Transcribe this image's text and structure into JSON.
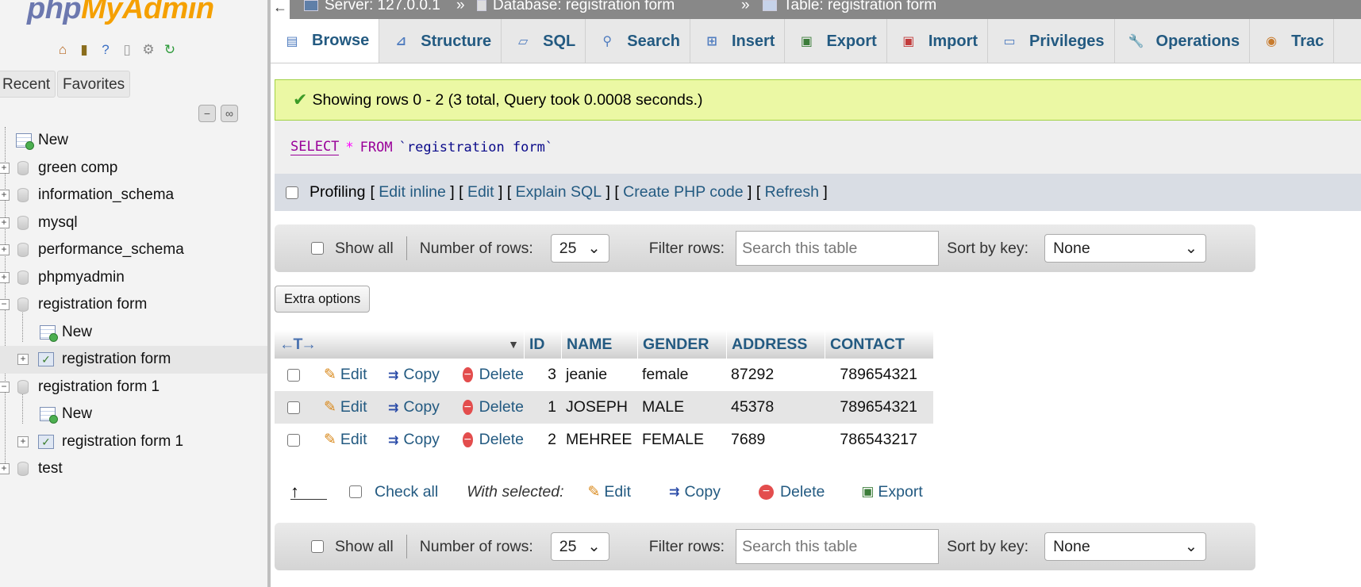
{
  "sidebar": {
    "logo_php": "php",
    "logo_myadmin": "MyAdmin",
    "tabs": {
      "recent": "Recent",
      "favorites": "Favorites"
    },
    "tree": [
      {
        "label": "New",
        "type": "new"
      },
      {
        "label": "green comp",
        "type": "db"
      },
      {
        "label": "information_schema",
        "type": "db"
      },
      {
        "label": "mysql",
        "type": "db"
      },
      {
        "label": "performance_schema",
        "type": "db"
      },
      {
        "label": "phpmyadmin",
        "type": "db"
      },
      {
        "label": "registration form",
        "type": "db-open"
      },
      {
        "label": "New",
        "type": "child-new"
      },
      {
        "label": "registration form",
        "type": "child-table"
      },
      {
        "label": "registration form 1",
        "type": "db-open"
      },
      {
        "label": "New",
        "type": "child-new"
      },
      {
        "label": "registration form 1",
        "type": "child-table"
      },
      {
        "label": "test",
        "type": "db"
      }
    ]
  },
  "breadcrumb": {
    "server": "Server: 127.0.0.1",
    "sep": "»",
    "database": "Database: registration form",
    "table": "Table: registration form"
  },
  "tabs": [
    {
      "label": "Browse",
      "icon": "browse-icon",
      "active": true
    },
    {
      "label": "Structure",
      "icon": "structure-icon"
    },
    {
      "label": "SQL",
      "icon": "sql-icon"
    },
    {
      "label": "Search",
      "icon": "search-icon"
    },
    {
      "label": "Insert",
      "icon": "insert-icon"
    },
    {
      "label": "Export",
      "icon": "export-icon"
    },
    {
      "label": "Import",
      "icon": "import-icon"
    },
    {
      "label": "Privileges",
      "icon": "privileges-icon"
    },
    {
      "label": "Operations",
      "icon": "operations-icon"
    },
    {
      "label": "Trac",
      "icon": "tracking-icon"
    }
  ],
  "success_message": "Showing rows 0 - 2 (3 total, Query took 0.0008 seconds.)",
  "sql": {
    "select": "SELECT",
    "star": "*",
    "from": "FROM",
    "table": "`registration form`"
  },
  "profiling": {
    "label": "Profiling",
    "links": [
      "Edit inline",
      "Edit",
      "Explain SQL",
      "Create PHP code",
      "Refresh"
    ]
  },
  "nav": {
    "show_all": "Show all",
    "number_of_rows": "Number of rows:",
    "rows_value": "25",
    "filter_rows": "Filter rows:",
    "filter_placeholder": "Search this table",
    "sort_by_key": "Sort by key:",
    "sort_value": "None"
  },
  "extra_options": "Extra options",
  "table": {
    "arrows": "←T→",
    "columns": [
      "ID",
      "NAME",
      "GENDER",
      "ADDRESS",
      "CONTACT"
    ],
    "actions": {
      "edit": "Edit",
      "copy": "Copy",
      "delete": "Delete"
    },
    "rows": [
      {
        "id": "3",
        "name": "jeanie",
        "gender": "female",
        "address": "87292",
        "contact": "789654321"
      },
      {
        "id": "1",
        "name": "JOSEPH",
        "gender": "MALE",
        "address": "45378",
        "contact": "789654321"
      },
      {
        "id": "2",
        "name": "MEHREE",
        "gender": "FEMALE",
        "address": "7689",
        "contact": "786543217"
      }
    ]
  },
  "bulk": {
    "check_all": "Check all",
    "with_selected": "With selected:",
    "edit": "Edit",
    "copy": "Copy",
    "delete": "Delete",
    "export": "Export"
  }
}
